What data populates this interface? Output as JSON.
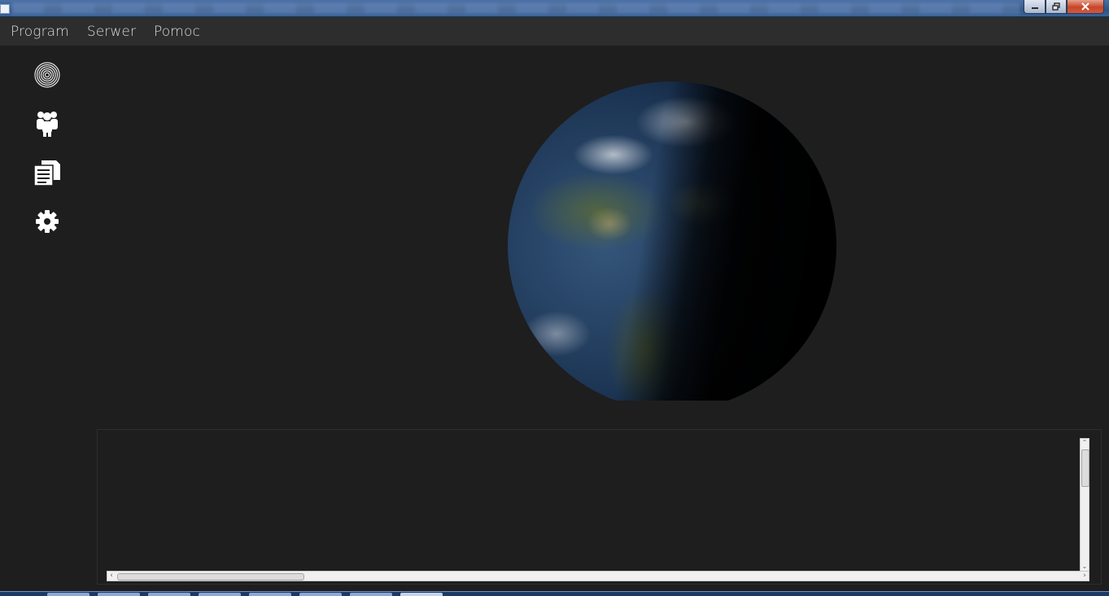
{
  "window": {
    "title": "",
    "controls": [
      "minimize-icon",
      "maximize-icon",
      "close-icon"
    ]
  },
  "menu": {
    "items": [
      "Program",
      "Serwer",
      "Pomoc"
    ]
  },
  "sidebar": {
    "items": [
      {
        "icon": "fingerprint-icon"
      },
      {
        "icon": "users-icon"
      },
      {
        "icon": "document-icon"
      },
      {
        "icon": "gear-icon"
      }
    ]
  },
  "colors": {
    "background": "#1e1e1e",
    "menubar": "#2d2d2d",
    "menu_text": "#dcdcdc",
    "icon": "#ffffff"
  }
}
